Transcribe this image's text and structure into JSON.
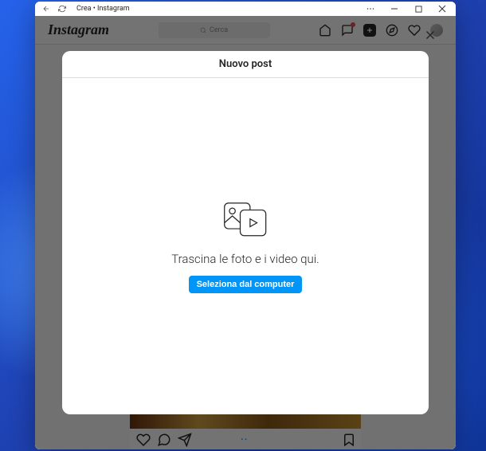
{
  "window": {
    "title": "Crea • Instagram"
  },
  "header": {
    "logo": "Instagram",
    "search_placeholder": "Cerca"
  },
  "modal": {
    "title": "Nuovo post",
    "drag_text": "Trascina le foto e i video qui.",
    "select_button": "Seleziona dal computer"
  }
}
